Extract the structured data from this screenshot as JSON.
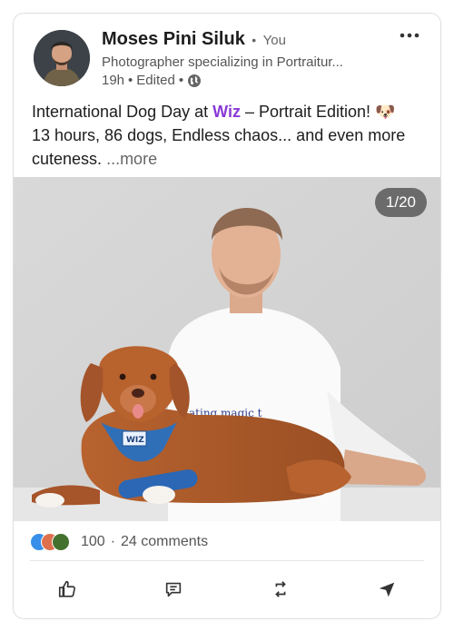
{
  "post": {
    "author": {
      "name": "Moses Pini Siluk",
      "separator": "•",
      "relation": "You",
      "headline": "Photographer specializing in Portraitur...",
      "time": "19h",
      "edited": "Edited",
      "visibility_icon": "globe-icon"
    },
    "menu_icon": "more-horizontal-icon",
    "text": {
      "line1_prefix": "International Dog Day at ",
      "brand": "Wiz",
      "line1_suffix": " – Portrait Edition! 🐶",
      "line2": "13 hours, 86 dogs, Endless chaos... and even more cuteness.",
      "see_more": "...more"
    },
    "image": {
      "counter": "1/20",
      "shirt_text": "ating magic t",
      "bandana_text": "WIZ"
    },
    "social": {
      "reaction_count": "100",
      "separator": "·",
      "comments": "24 comments",
      "reaction_icons": [
        "like-icon",
        "love-icon",
        "support-icon"
      ]
    },
    "actions": [
      {
        "name": "like",
        "icon": "thumbs-up-icon"
      },
      {
        "name": "comment",
        "icon": "comment-icon"
      },
      {
        "name": "repost",
        "icon": "repost-icon"
      },
      {
        "name": "send",
        "icon": "send-icon"
      }
    ]
  },
  "colors": {
    "brand": "#8a3ad6",
    "reaction_like": "#378fe9",
    "reaction_love": "#df704d",
    "reaction_support": "#44712e"
  }
}
